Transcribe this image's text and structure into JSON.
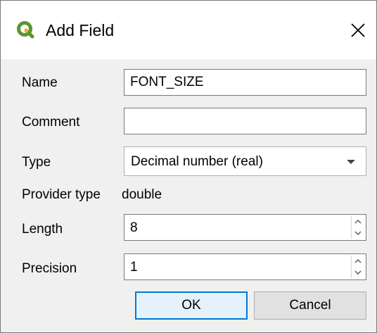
{
  "dialog": {
    "title": "Add Field",
    "icon": "qgis-logo-icon",
    "close": "close-icon"
  },
  "form": {
    "name_label": "Name",
    "name_value": "FONT_SIZE",
    "comment_label": "Comment",
    "comment_value": "",
    "type_label": "Type",
    "type_value": "Decimal number (real)",
    "provider_type_label": "Provider type",
    "provider_type_value": "double",
    "length_label": "Length",
    "length_value": "8",
    "precision_label": "Precision",
    "precision_value": "1"
  },
  "buttons": {
    "ok": "OK",
    "cancel": "Cancel"
  },
  "colors": {
    "qgis_green": "#589632",
    "qgis_yellow": "#eeb32a",
    "focus_blue": "#0078d7"
  }
}
